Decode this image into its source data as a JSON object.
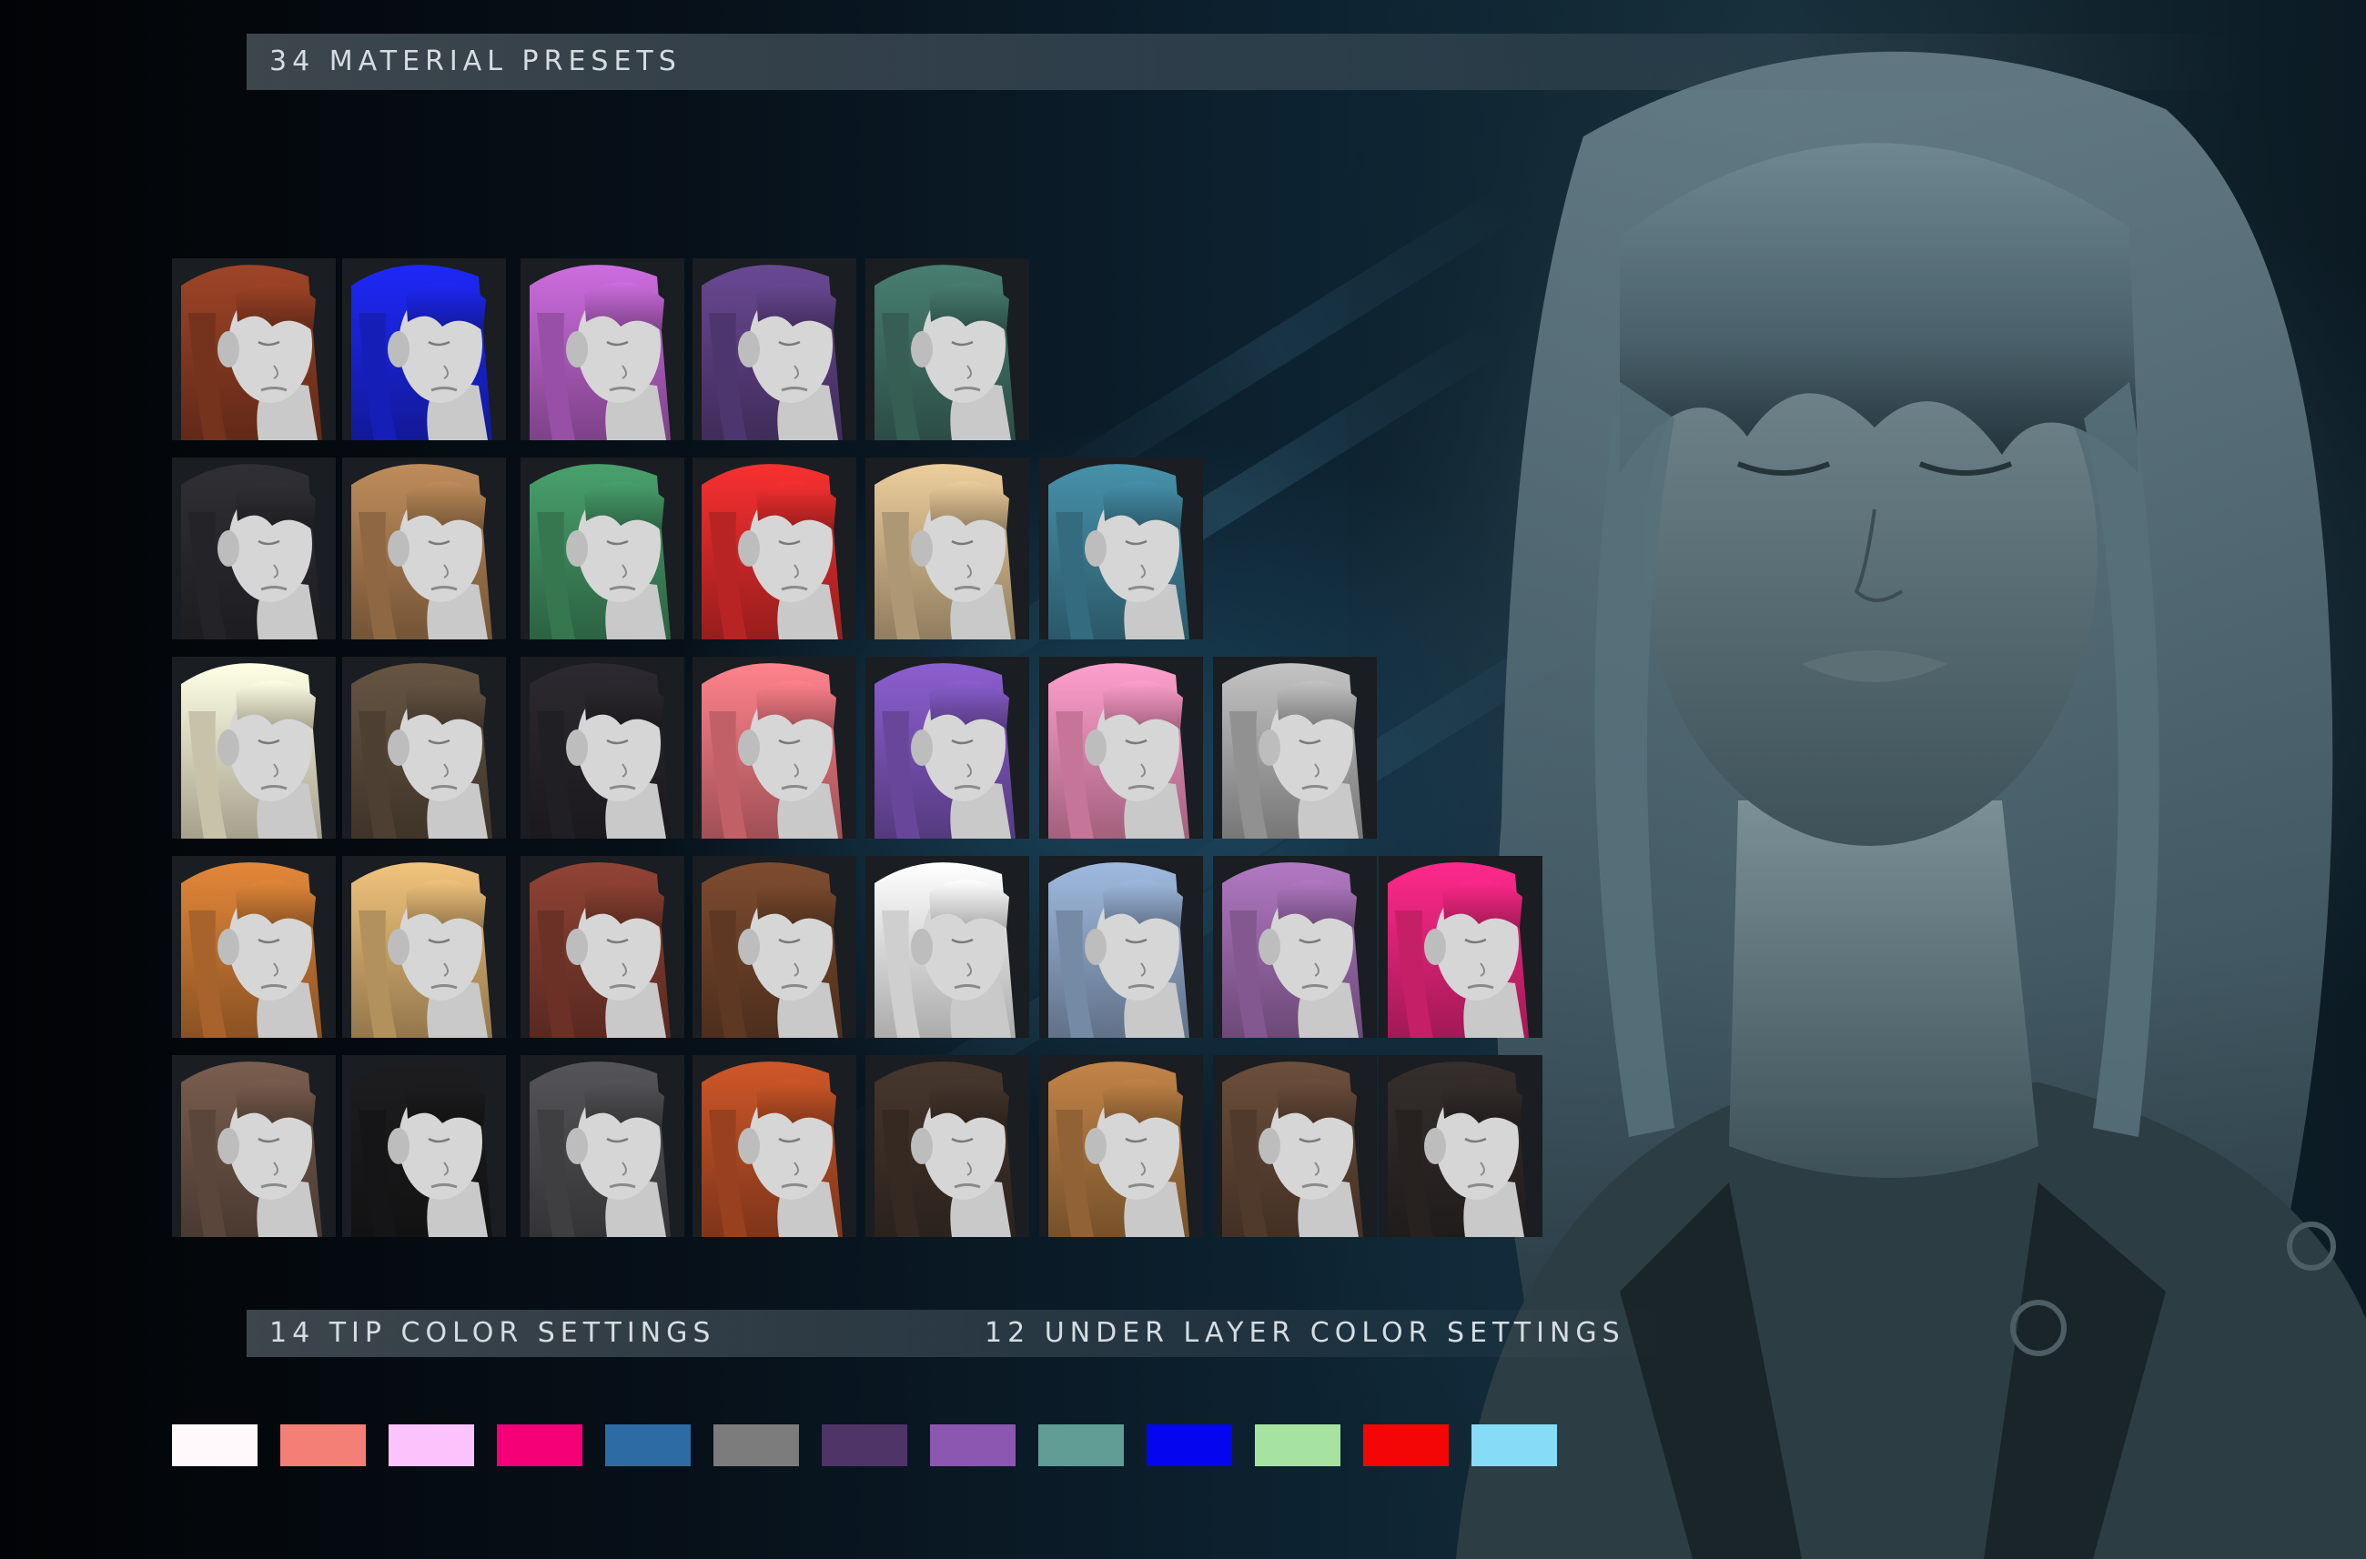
{
  "headers": {
    "presets_title": "34 MATERIAL PRESETS",
    "tip_title": "14 TIP COLOR SETTINGS",
    "under_title": "12 UNDER LAYER COLOR SETTINGS"
  },
  "presets": {
    "rows": [
      [
        "#8a3b22",
        "#1a23d8",
        "#b25ec2",
        "#5b3f80",
        "#3f6e62"
      ],
      [
        "#2a292e",
        "#a67a4e",
        "#3f8c5e",
        "#d82a2a",
        "#cdb288",
        "#3d7e94"
      ],
      [
        "#ece4c8",
        "#5a4a3a",
        "#26242a",
        "#e4717a",
        "#7a53b6",
        "#e88ab2",
        "#aaaaaa"
      ],
      [
        "#c57532",
        "#d2aa6c",
        "#7e3a2e",
        "#6e4229",
        "#f4f4f4",
        "#8aa2c2",
        "#9a68aa",
        "#e8247a"
      ],
      [
        "#6a5245",
        "#19191b",
        "#4a4a4d",
        "#b44c24",
        "#3e3028",
        "#a9733e",
        "#5e4434",
        "#2e2826"
      ]
    ]
  },
  "swatches": [
    "#fff9fb",
    "#f47f77",
    "#fcc2fb",
    "#f40077",
    "#2c6ba4",
    "#7c7c7c",
    "#4e3467",
    "#8c57b0",
    "#619c95",
    "#0505ef",
    "#a7e3a0",
    "#f40506",
    "#86dcf6"
  ]
}
